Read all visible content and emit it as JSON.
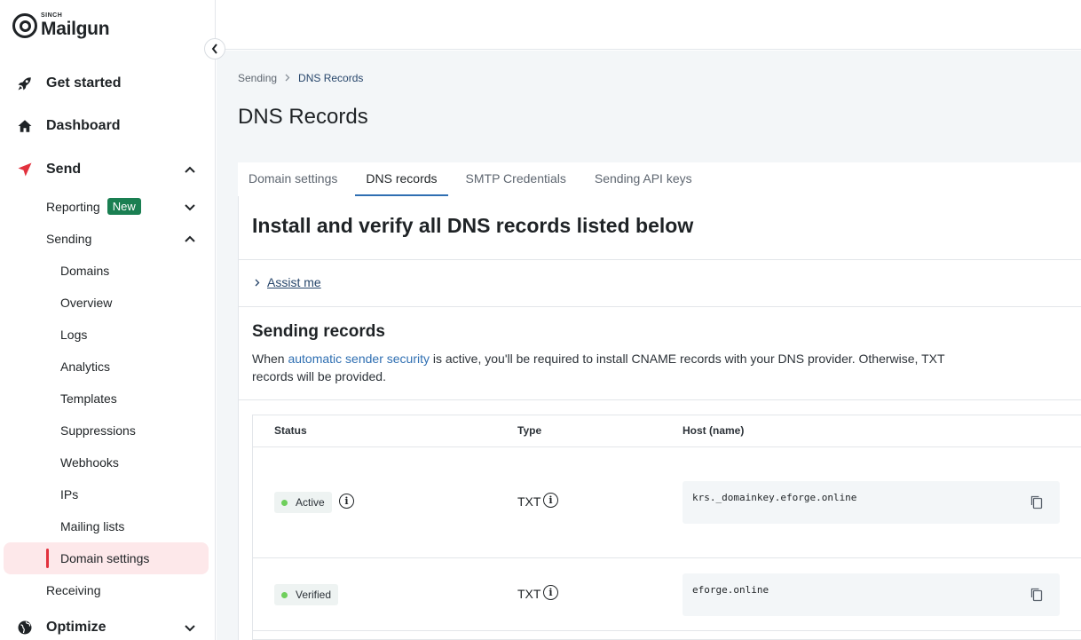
{
  "brand": {
    "tagline": "SINCH",
    "name": "Mailgun"
  },
  "sidebar": {
    "main_items": [
      {
        "label": "Get started",
        "icon": "rocket-icon"
      },
      {
        "label": "Dashboard",
        "icon": "home-icon"
      },
      {
        "label": "Send",
        "icon": "send-icon"
      },
      {
        "label": "Optimize",
        "icon": "globe-icon"
      }
    ],
    "send_sub": {
      "reporting": "Reporting",
      "reporting_badge": "New",
      "sending": "Sending",
      "receiving": "Receiving"
    },
    "sending_items": [
      "Domains",
      "Overview",
      "Logs",
      "Analytics",
      "Templates",
      "Suppressions",
      "Webhooks",
      "IPs",
      "Mailing lists",
      "Domain settings"
    ],
    "active_item": "Domain settings",
    "accent_color": "#e2323e"
  },
  "breadcrumb": {
    "parent": "Sending",
    "current": "DNS Records"
  },
  "page": {
    "title": "DNS Records"
  },
  "tabs": [
    "Domain settings",
    "DNS records",
    "SMTP Credentials",
    "Sending API keys"
  ],
  "active_tab": "DNS records",
  "content": {
    "install_title": "Install and verify all DNS records listed below",
    "assist_label": "Assist me",
    "sending_records_title": "Sending records",
    "desc_before": "When ",
    "desc_link": "automatic sender security",
    "desc_after": " is active, you'll be required to install CNAME records with your DNS provider. Otherwise, TXT records will be provided."
  },
  "table": {
    "headers": {
      "status": "Status",
      "type": "Type",
      "host": "Host (name)"
    },
    "rows": [
      {
        "status": "Active",
        "type": "TXT",
        "host": "krs._domainkey.eforge.online"
      },
      {
        "status": "Verified",
        "type": "TXT",
        "host": "eforge.online"
      }
    ]
  }
}
